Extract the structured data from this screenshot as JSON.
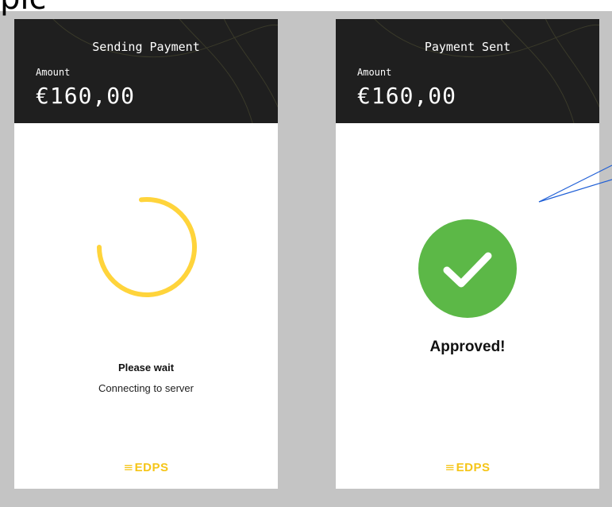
{
  "fragment_text": "pic",
  "left_panel": {
    "title": "Sending Payment",
    "amount_label": "Amount",
    "amount_value": "€160,00",
    "status_title": "Please wait",
    "status_subtitle": "Connecting to server",
    "logo_text": "EDPS"
  },
  "right_panel": {
    "title": "Payment Sent",
    "amount_label": "Amount",
    "amount_value": "€160,00",
    "status_title": "Approved!",
    "logo_text": "EDPS"
  },
  "icons": {
    "spinner": "loading-spinner-icon",
    "success": "check-circle-icon",
    "logo": "edps-logo-mark"
  },
  "colors": {
    "header_bg": "#1f1f1f",
    "spinner": "#ffd43b",
    "success": "#5cb847",
    "brand": "#f5c518",
    "annotation_line": "#1f5fd6"
  }
}
